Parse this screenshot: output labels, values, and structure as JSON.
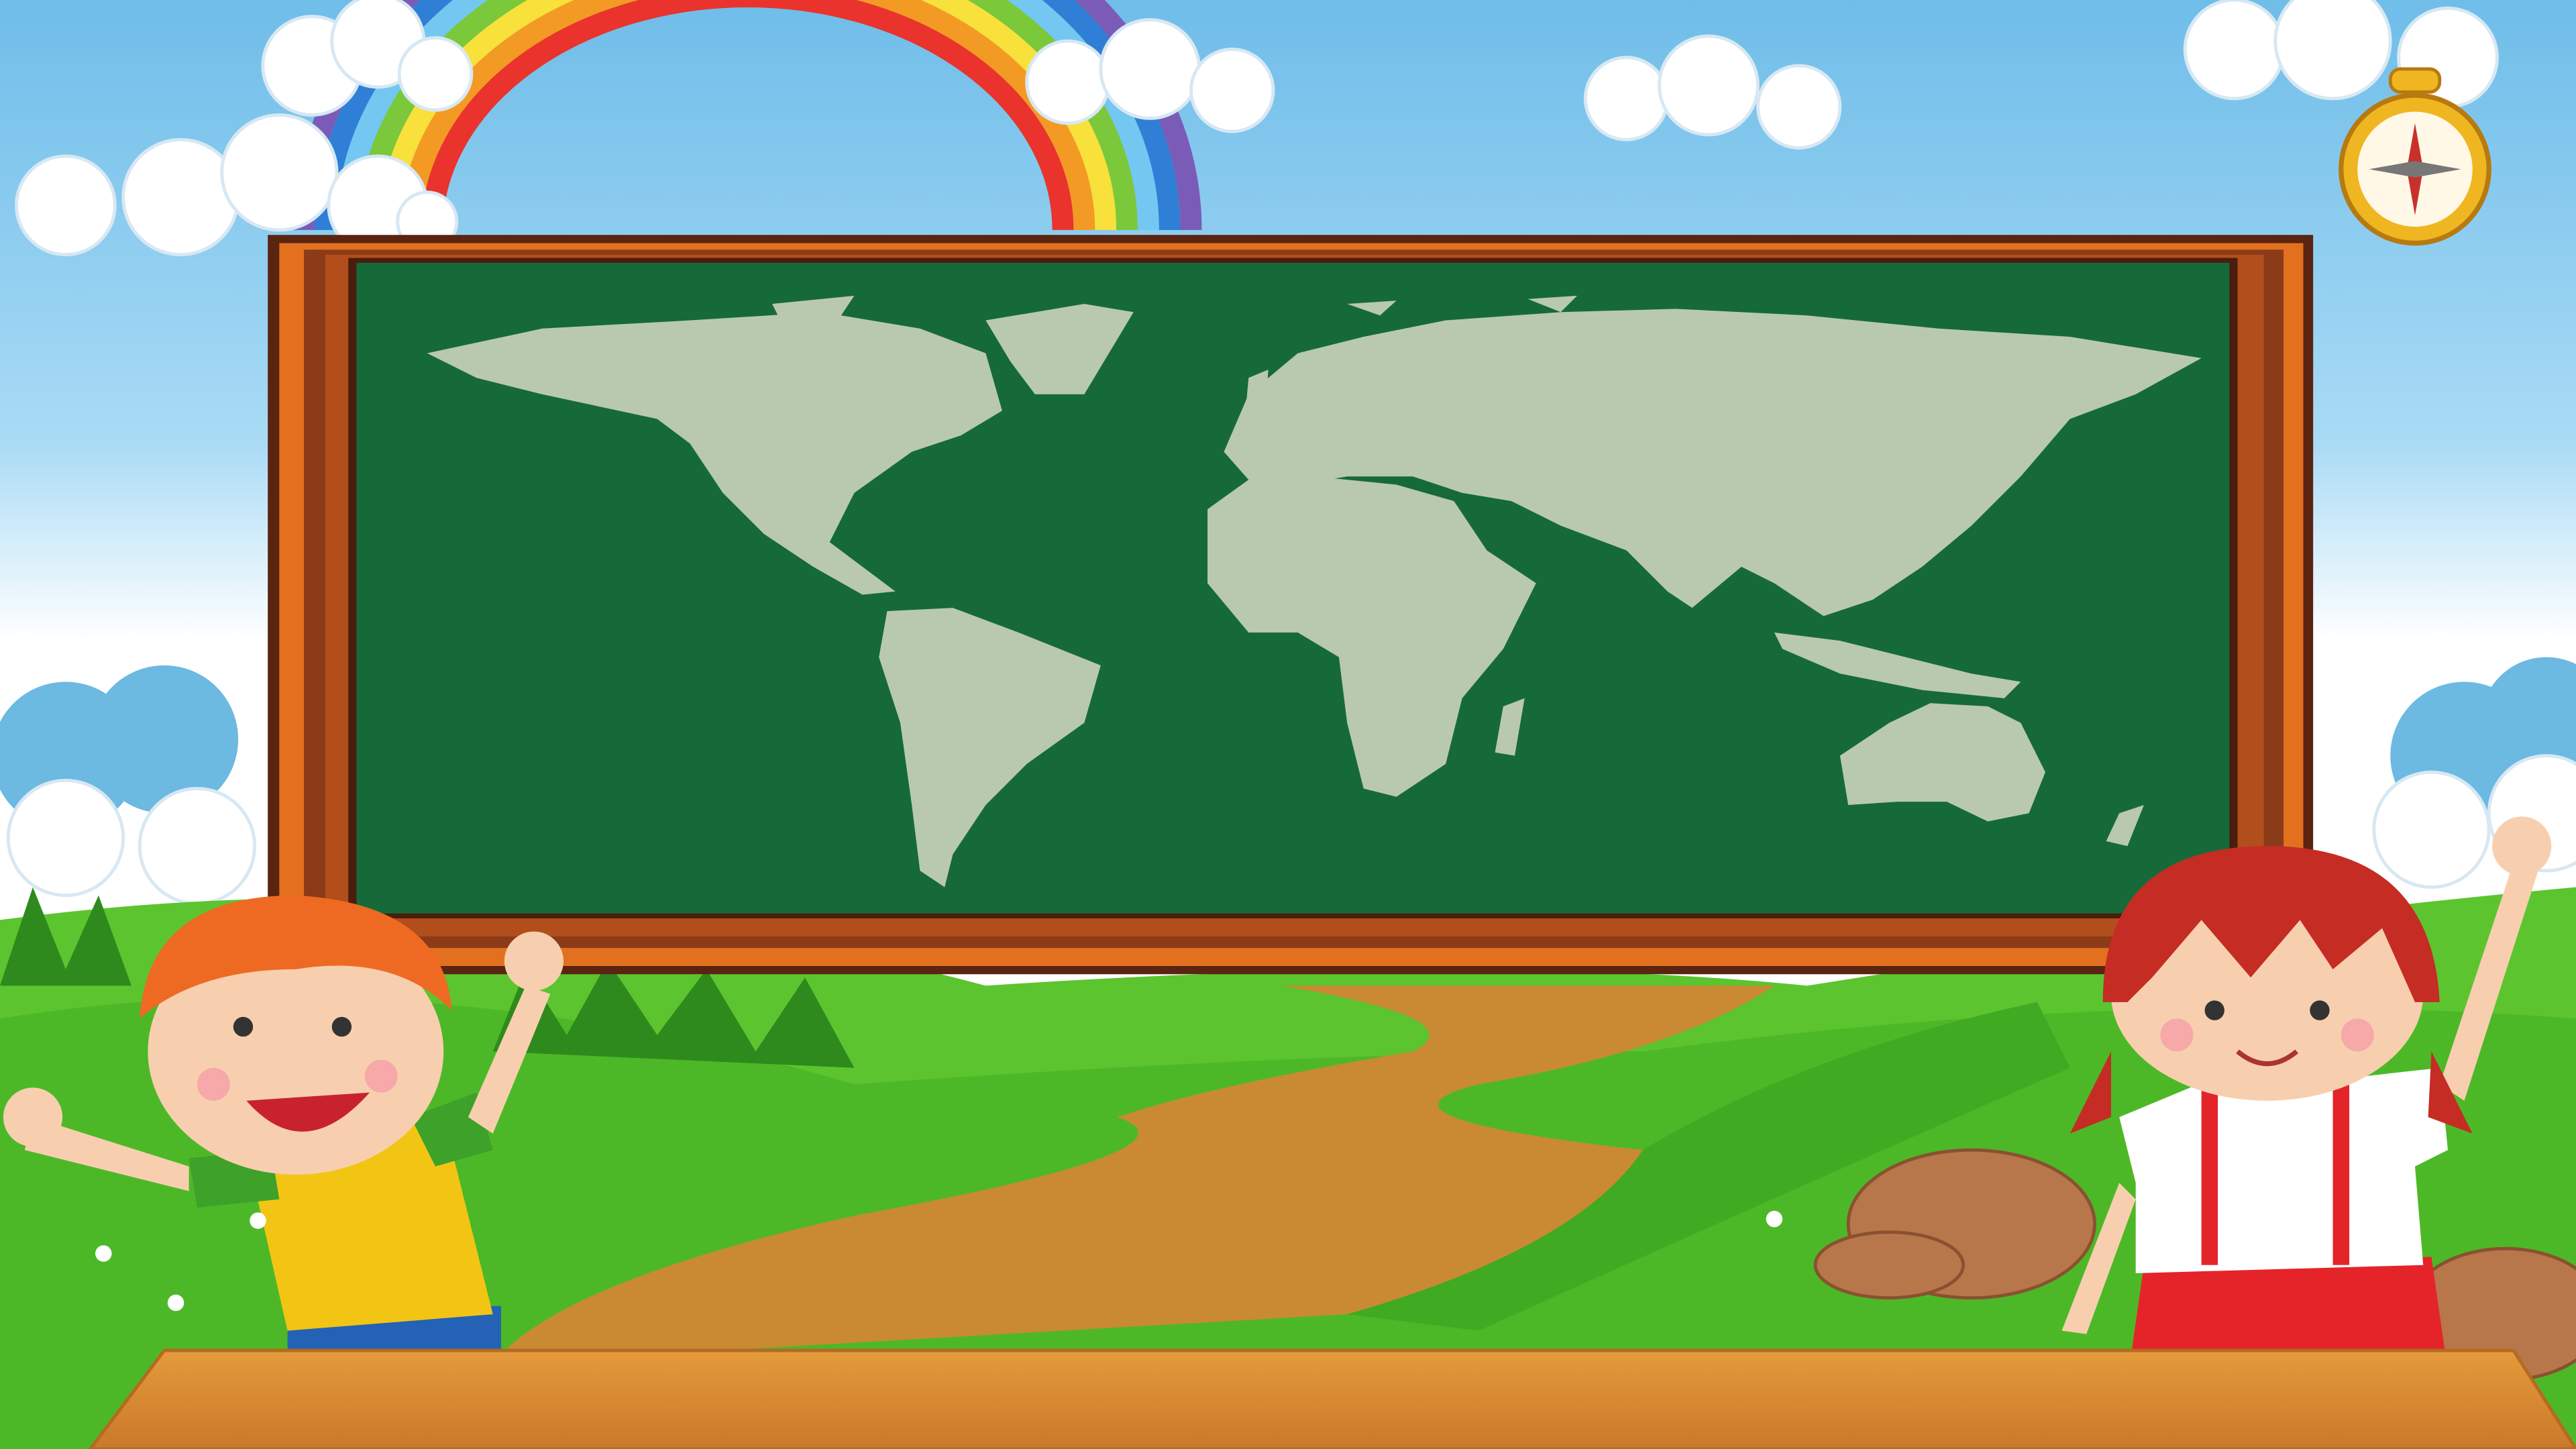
{
  "colors": {
    "sky_top": "#7cc3ec",
    "sky_bottom": "#ffffff",
    "board_green": "#166a3a",
    "continent": "#b9c9ae",
    "frame_orange": "#e2701f",
    "frame_dark": "#5a2411",
    "grass": "#4cbb2a",
    "path": "#c98a33",
    "table": "#d98d2f"
  }
}
